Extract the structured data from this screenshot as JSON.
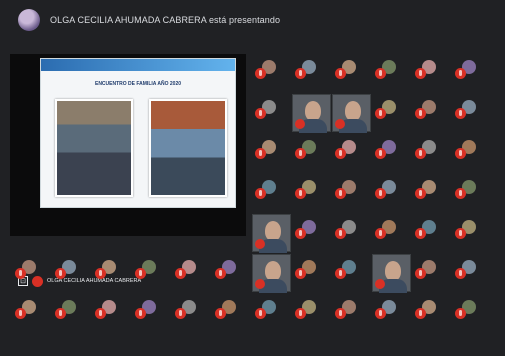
{
  "presentation_banner": {
    "text": "OLGA CECILIA AHUMADA CABRERA está presentando"
  },
  "stage": {
    "presenter_name": "OLGA CECILIA AHUMADA CABRERA"
  },
  "slide": {
    "title": "ENCUENTRO DE FAMILIA AÑO 2020"
  },
  "colors": {
    "meet_bg": "#202124",
    "muted_red": "#d93025"
  }
}
